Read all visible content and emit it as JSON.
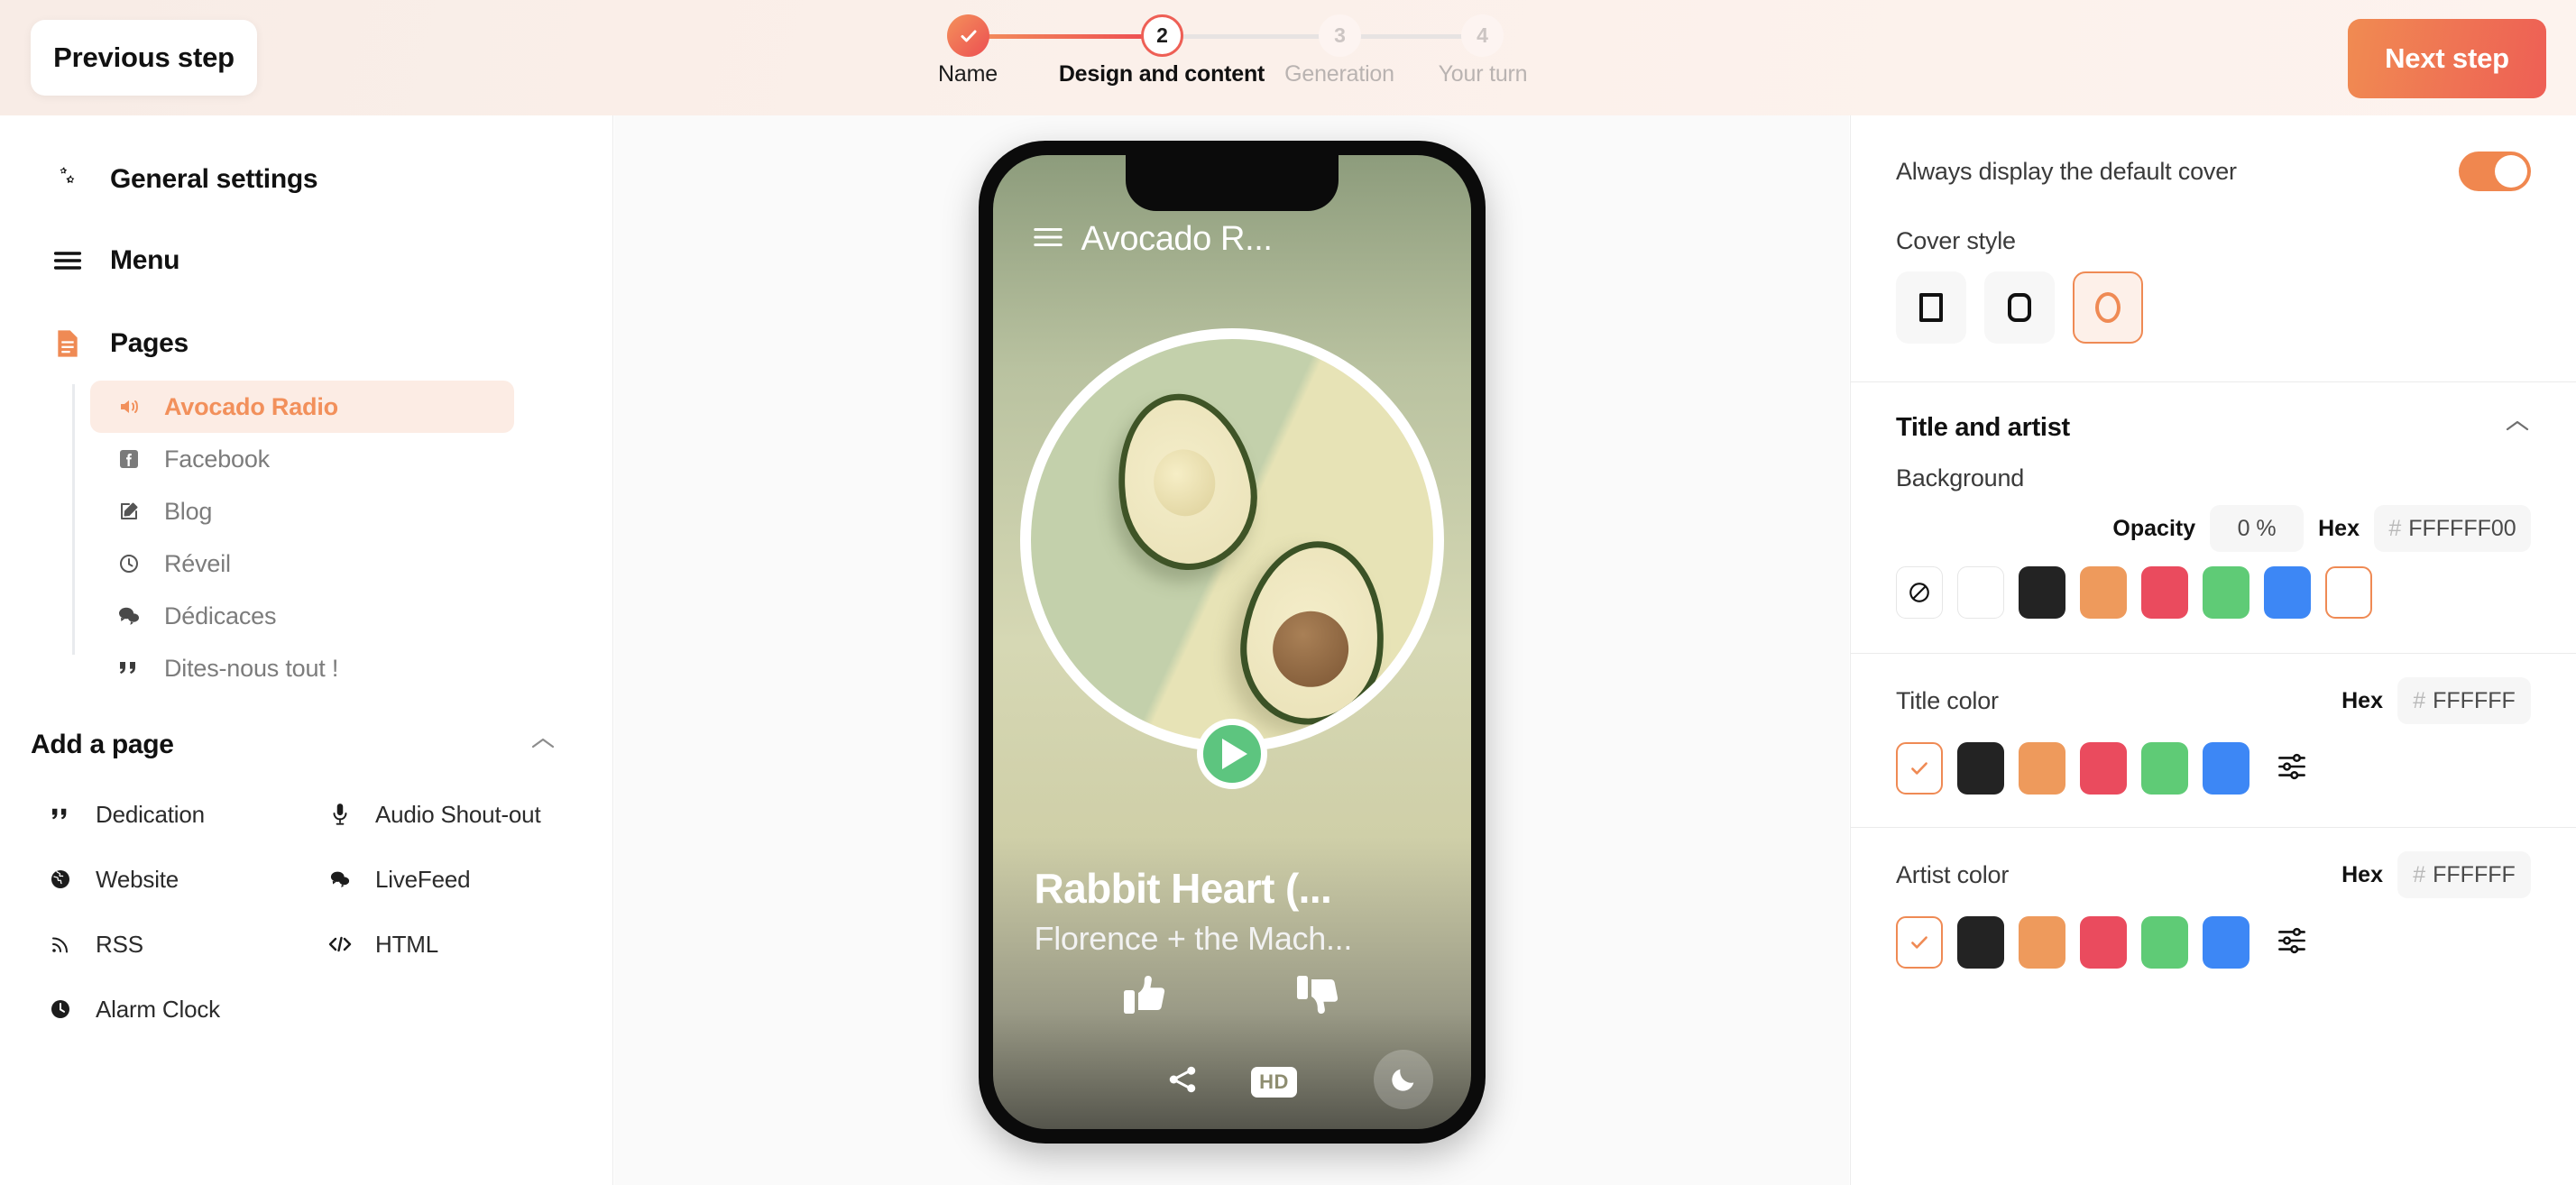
{
  "topbar": {
    "previous_label": "Previous step",
    "next_label": "Next step",
    "stepper": {
      "steps": [
        {
          "num": "1",
          "label": "Name",
          "state": "complete"
        },
        {
          "num": "2",
          "label": "Design and content",
          "state": "current"
        },
        {
          "num": "3",
          "label": "Generation",
          "state": "future"
        },
        {
          "num": "4",
          "label": "Your turn",
          "state": "future"
        }
      ]
    }
  },
  "sidebar": {
    "general_settings": "General settings",
    "menu": "Menu",
    "pages_label": "Pages",
    "pages": [
      {
        "label": "Avocado Radio",
        "icon": "speaker-icon",
        "active": true
      },
      {
        "label": "Facebook",
        "icon": "facebook-icon",
        "active": false
      },
      {
        "label": "Blog",
        "icon": "edit-icon",
        "active": false
      },
      {
        "label": "Réveil",
        "icon": "clock-icon",
        "active": false
      },
      {
        "label": "Dédicaces",
        "icon": "chat-icon",
        "active": false
      },
      {
        "label": "Dites-nous tout !",
        "icon": "quote-icon",
        "active": false
      }
    ],
    "add_a_page": "Add a page",
    "add_items": [
      {
        "label": "Dedication",
        "icon": "quote-icon"
      },
      {
        "label": "Audio Shout-out",
        "icon": "microphone-icon"
      },
      {
        "label": "Website",
        "icon": "globe-icon"
      },
      {
        "label": "LiveFeed",
        "icon": "chat-icon"
      },
      {
        "label": "RSS",
        "icon": "rss-icon"
      },
      {
        "label": "HTML",
        "icon": "code-icon"
      },
      {
        "label": "Alarm Clock",
        "icon": "clock-icon"
      }
    ]
  },
  "preview": {
    "app_title": "Avocado R...",
    "track_title": "Rabbit Heart (...",
    "track_artist": "Florence + the Mach...",
    "hd_badge": "HD"
  },
  "right_panel": {
    "default_cover_label": "Always display the default cover",
    "default_cover_on": true,
    "cover_style_label": "Cover style",
    "cover_styles": [
      {
        "name": "square",
        "selected": false
      },
      {
        "name": "rounded",
        "selected": false
      },
      {
        "name": "circle",
        "selected": true
      }
    ],
    "title_and_artist": {
      "section_title": "Title and artist",
      "background_label": "Background",
      "opacity_label": "Opacity",
      "opacity_value": "0 %",
      "hex_label": "Hex",
      "background_hex": "FFFFFF00",
      "background_swatches": [
        "none",
        "#FFFFFF",
        "#232323",
        "#EE9A5C",
        "#EA4B5E",
        "#5FCB76",
        "#3D87F5",
        "#FFFFFF"
      ],
      "background_selected_index": 7,
      "title_color_label": "Title color",
      "title_hex_label": "Hex",
      "title_hex": "FFFFFF",
      "title_swatches": [
        "#FFFFFF",
        "#232323",
        "#EE9A5C",
        "#EA4B5E",
        "#5FCB76",
        "#3D87F5"
      ],
      "title_selected_index": 0,
      "artist_color_label": "Artist color",
      "artist_hex_label": "Hex",
      "artist_hex": "FFFFFF",
      "artist_swatches": [
        "#FFFFFF",
        "#232323",
        "#EE9A5C",
        "#EA4B5E",
        "#5FCB76",
        "#3D87F5"
      ],
      "artist_selected_index": 0
    }
  },
  "colors": {
    "accent": "#EF8A54",
    "accent_red": "#EE5F55",
    "green_play": "#5DC57F"
  }
}
